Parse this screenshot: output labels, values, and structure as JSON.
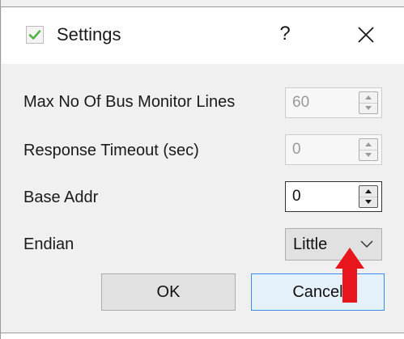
{
  "window": {
    "title": "Settings",
    "help_label": "?",
    "close_label": "✕"
  },
  "fields": [
    {
      "label": "Max No Of Bus Monitor Lines",
      "value": "60",
      "enabled": false
    },
    {
      "label": "Response Timeout (sec)",
      "value": "0",
      "enabled": false
    },
    {
      "label": "Base Addr",
      "value": "0",
      "enabled": true
    },
    {
      "label": "Endian",
      "value": "Little",
      "type": "dropdown"
    }
  ],
  "buttons": {
    "ok_label": "OK",
    "cancel_label": "Cancel"
  },
  "colors": {
    "accent_green": "#54b34a",
    "focus_blue": "#3a8ee6",
    "annotation_red": "#e8161c"
  },
  "icons": {
    "title_checkbox": "checkbox-checked-icon",
    "close": "close-icon",
    "spin_up": "chevron-up-icon",
    "spin_down": "chevron-down-icon",
    "dropdown": "chevron-down-icon",
    "annotation": "red-arrow-icon"
  }
}
